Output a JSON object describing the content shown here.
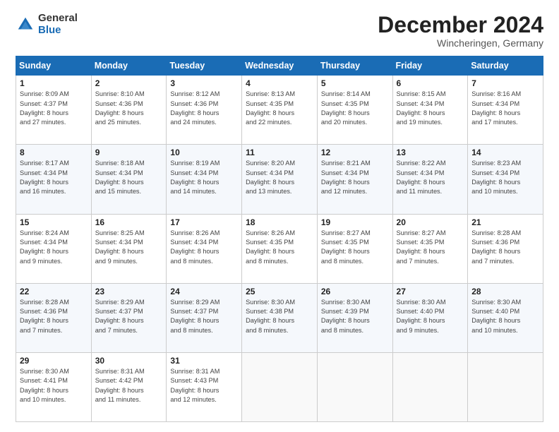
{
  "header": {
    "logo_general": "General",
    "logo_blue": "Blue",
    "month": "December 2024",
    "location": "Wincheringen, Germany"
  },
  "days_of_week": [
    "Sunday",
    "Monday",
    "Tuesday",
    "Wednesday",
    "Thursday",
    "Friday",
    "Saturday"
  ],
  "weeks": [
    [
      {
        "day": "1",
        "text": "Sunrise: 8:09 AM\nSunset: 4:37 PM\nDaylight: 8 hours\nand 27 minutes."
      },
      {
        "day": "2",
        "text": "Sunrise: 8:10 AM\nSunset: 4:36 PM\nDaylight: 8 hours\nand 25 minutes."
      },
      {
        "day": "3",
        "text": "Sunrise: 8:12 AM\nSunset: 4:36 PM\nDaylight: 8 hours\nand 24 minutes."
      },
      {
        "day": "4",
        "text": "Sunrise: 8:13 AM\nSunset: 4:35 PM\nDaylight: 8 hours\nand 22 minutes."
      },
      {
        "day": "5",
        "text": "Sunrise: 8:14 AM\nSunset: 4:35 PM\nDaylight: 8 hours\nand 20 minutes."
      },
      {
        "day": "6",
        "text": "Sunrise: 8:15 AM\nSunset: 4:34 PM\nDaylight: 8 hours\nand 19 minutes."
      },
      {
        "day": "7",
        "text": "Sunrise: 8:16 AM\nSunset: 4:34 PM\nDaylight: 8 hours\nand 17 minutes."
      }
    ],
    [
      {
        "day": "8",
        "text": "Sunrise: 8:17 AM\nSunset: 4:34 PM\nDaylight: 8 hours\nand 16 minutes."
      },
      {
        "day": "9",
        "text": "Sunrise: 8:18 AM\nSunset: 4:34 PM\nDaylight: 8 hours\nand 15 minutes."
      },
      {
        "day": "10",
        "text": "Sunrise: 8:19 AM\nSunset: 4:34 PM\nDaylight: 8 hours\nand 14 minutes."
      },
      {
        "day": "11",
        "text": "Sunrise: 8:20 AM\nSunset: 4:34 PM\nDaylight: 8 hours\nand 13 minutes."
      },
      {
        "day": "12",
        "text": "Sunrise: 8:21 AM\nSunset: 4:34 PM\nDaylight: 8 hours\nand 12 minutes."
      },
      {
        "day": "13",
        "text": "Sunrise: 8:22 AM\nSunset: 4:34 PM\nDaylight: 8 hours\nand 11 minutes."
      },
      {
        "day": "14",
        "text": "Sunrise: 8:23 AM\nSunset: 4:34 PM\nDaylight: 8 hours\nand 10 minutes."
      }
    ],
    [
      {
        "day": "15",
        "text": "Sunrise: 8:24 AM\nSunset: 4:34 PM\nDaylight: 8 hours\nand 9 minutes."
      },
      {
        "day": "16",
        "text": "Sunrise: 8:25 AM\nSunset: 4:34 PM\nDaylight: 8 hours\nand 9 minutes."
      },
      {
        "day": "17",
        "text": "Sunrise: 8:26 AM\nSunset: 4:34 PM\nDaylight: 8 hours\nand 8 minutes."
      },
      {
        "day": "18",
        "text": "Sunrise: 8:26 AM\nSunset: 4:35 PM\nDaylight: 8 hours\nand 8 minutes."
      },
      {
        "day": "19",
        "text": "Sunrise: 8:27 AM\nSunset: 4:35 PM\nDaylight: 8 hours\nand 8 minutes."
      },
      {
        "day": "20",
        "text": "Sunrise: 8:27 AM\nSunset: 4:35 PM\nDaylight: 8 hours\nand 7 minutes."
      },
      {
        "day": "21",
        "text": "Sunrise: 8:28 AM\nSunset: 4:36 PM\nDaylight: 8 hours\nand 7 minutes."
      }
    ],
    [
      {
        "day": "22",
        "text": "Sunrise: 8:28 AM\nSunset: 4:36 PM\nDaylight: 8 hours\nand 7 minutes."
      },
      {
        "day": "23",
        "text": "Sunrise: 8:29 AM\nSunset: 4:37 PM\nDaylight: 8 hours\nand 7 minutes."
      },
      {
        "day": "24",
        "text": "Sunrise: 8:29 AM\nSunset: 4:37 PM\nDaylight: 8 hours\nand 8 minutes."
      },
      {
        "day": "25",
        "text": "Sunrise: 8:30 AM\nSunset: 4:38 PM\nDaylight: 8 hours\nand 8 minutes."
      },
      {
        "day": "26",
        "text": "Sunrise: 8:30 AM\nSunset: 4:39 PM\nDaylight: 8 hours\nand 8 minutes."
      },
      {
        "day": "27",
        "text": "Sunrise: 8:30 AM\nSunset: 4:40 PM\nDaylight: 8 hours\nand 9 minutes."
      },
      {
        "day": "28",
        "text": "Sunrise: 8:30 AM\nSunset: 4:40 PM\nDaylight: 8 hours\nand 10 minutes."
      }
    ],
    [
      {
        "day": "29",
        "text": "Sunrise: 8:30 AM\nSunset: 4:41 PM\nDaylight: 8 hours\nand 10 minutes."
      },
      {
        "day": "30",
        "text": "Sunrise: 8:31 AM\nSunset: 4:42 PM\nDaylight: 8 hours\nand 11 minutes."
      },
      {
        "day": "31",
        "text": "Sunrise: 8:31 AM\nSunset: 4:43 PM\nDaylight: 8 hours\nand 12 minutes."
      },
      {
        "day": "",
        "text": ""
      },
      {
        "day": "",
        "text": ""
      },
      {
        "day": "",
        "text": ""
      },
      {
        "day": "",
        "text": ""
      }
    ]
  ]
}
